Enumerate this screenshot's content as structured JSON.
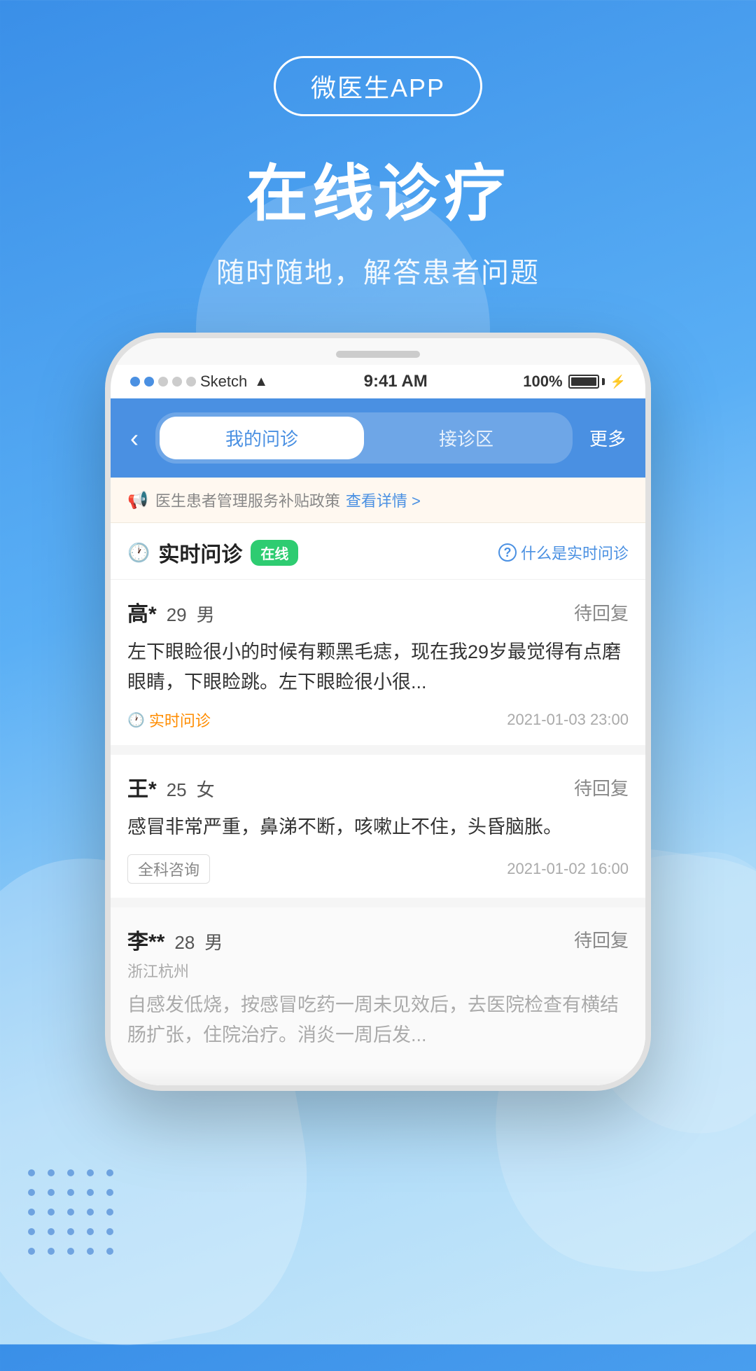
{
  "app": {
    "badge": "微医生APP",
    "main_title": "在线诊疗",
    "sub_title": "随时随地，解答患者问题"
  },
  "status_bar": {
    "signals": [
      "●",
      "●",
      "○",
      "○",
      "○"
    ],
    "carrier": "Sketch",
    "wifi": "WiFi",
    "time": "9:41 AM",
    "battery_pct": "100%"
  },
  "nav": {
    "tab_active": "我的问诊",
    "tab_inactive": "接诊区",
    "more": "更多"
  },
  "notice": {
    "icon": "🔔",
    "text": "医生患者管理服务补贴政策",
    "link": "查看详情 >"
  },
  "realtime": {
    "icon": "🕐",
    "label": "实时问诊",
    "online_badge": "在线",
    "help_icon": "?",
    "help_text": "什么是实时问诊"
  },
  "patients": [
    {
      "name": "高*",
      "age": "29",
      "gender": "男",
      "status": "待回复",
      "content": "左下眼睑很小的时候有颗黑毛痣，现在我29岁最觉得有点磨眼睛，下眼睑跳。左下眼睑很小很...",
      "tag_icon": "🕐",
      "tag_label": "实时问诊",
      "time": "2021-01-03 23:00",
      "location": "",
      "grayed": false
    },
    {
      "name": "王*",
      "age": "25",
      "gender": "女",
      "status": "待回复",
      "content": "感冒非常严重，鼻涕不断，咳嗽止不住，头昏脑胀。",
      "tag_icon": "",
      "tag_label": "全科咨询",
      "time": "2021-01-02 16:00",
      "location": "",
      "grayed": false
    },
    {
      "name": "李**",
      "age": "28",
      "gender": "男",
      "status": "待回复",
      "content": "自感发低烧，按感冒吃药一周未见效后，去医院检查有横结肠扩张，住院治疗。消炎一周后发...",
      "tag_icon": "",
      "tag_label": "",
      "time": "",
      "location": "浙江杭州",
      "grayed": true
    }
  ]
}
